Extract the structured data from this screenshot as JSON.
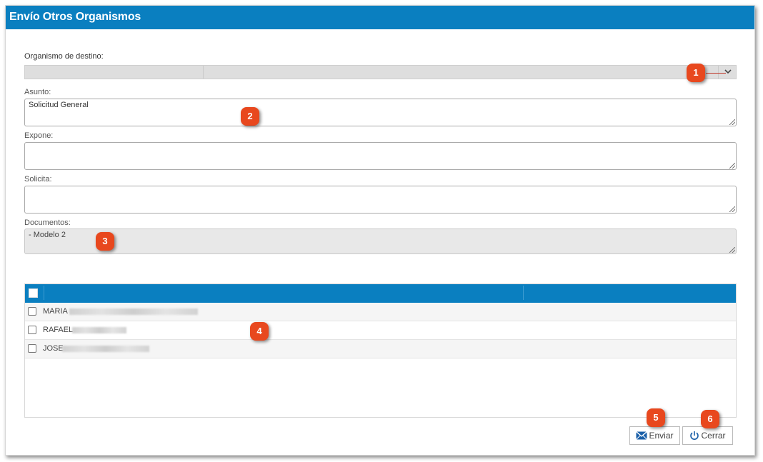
{
  "dialog": {
    "title": "Envío Otros Organismos"
  },
  "form": {
    "organismo_label": "Organismo de destino:",
    "asunto_label": "Asunto:",
    "asunto_value": "Solicitud General",
    "expone_label": "Expone:",
    "expone_value": "",
    "solicita_label": "Solicita:",
    "solicita_value": "",
    "documentos_label": "Documentos:",
    "documentos_value": "- Modelo 2"
  },
  "recipients": {
    "rows": [
      {
        "name": "MARIA"
      },
      {
        "name": "RAFAEL"
      },
      {
        "name": "JOSE"
      }
    ]
  },
  "buttons": {
    "send_label": "Enviar",
    "close_label": "Cerrar"
  },
  "annotations": [
    "1",
    "2",
    "3",
    "4",
    "5",
    "6"
  ],
  "colors": {
    "header": "#0a7fc0",
    "badge": "#e8481e"
  },
  "icons": {
    "dropdown": "chevron-down-icon",
    "send": "envelope-icon",
    "close": "power-icon"
  }
}
